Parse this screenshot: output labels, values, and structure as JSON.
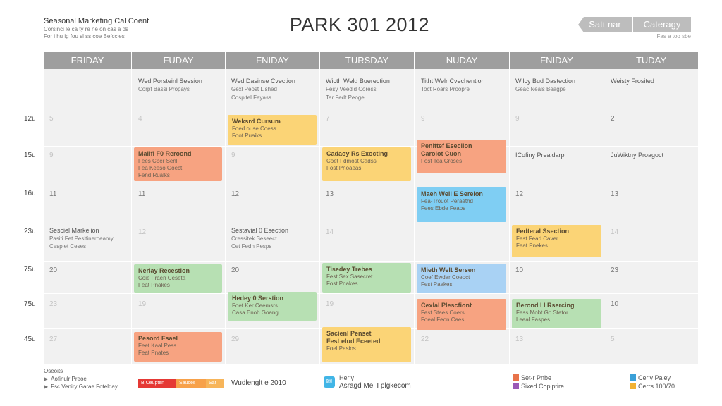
{
  "header": {
    "brand_title": "Seasonal Marketing Cal Coent",
    "brand_sub1": "Corsinci le ca ty re ne on cas a ds",
    "brand_sub2": "For i hu ig fou sl ss coe Befccles",
    "title": "PARK 301 2012",
    "btn_1": "Satt nar",
    "btn_2": "Cateragy",
    "sub_right": "Fas a too sbe"
  },
  "days": [
    "FRIDAY",
    "FUDAY",
    "FNIDAY",
    "TURSDAY",
    "NUDAY",
    "FNIDAY",
    "TUDAY"
  ],
  "subheads": [
    {
      "l1": "",
      "l2": ""
    },
    {
      "l1": "Wed Porsteinl Seesion",
      "l2": "Corpt Bassi Propays"
    },
    {
      "l1": "Wed Dasinse Cvection",
      "l2": "Gexl Peost Lished"
    },
    {
      "l1": "Wicth Weld Buerection",
      "l2": "Fesy Veedid Coress"
    },
    {
      "l1": "Titht Welr Cvechention",
      "l2": "Toct Roars Proopre"
    },
    {
      "l1": "Wilcy Bud Dastection",
      "l2": "Geac Neals Beagpe"
    },
    {
      "l1": "Weisty Frosited",
      "l2": ""
    }
  ],
  "subheads_l3": [
    "",
    "",
    "Cospitel Feyass",
    "Tar Fedt Peoge",
    "",
    "",
    ""
  ],
  "times": [
    "12u",
    "15u",
    "16u",
    "23u",
    "75u",
    "75u",
    "45u"
  ],
  "day_numbers": {
    "r1": [
      "5",
      "4",
      "",
      "7",
      "9",
      "9",
      "2"
    ],
    "r2": [
      "9",
      "",
      "9",
      "",
      "",
      "",
      ""
    ],
    "r3": [
      "11",
      "11",
      "12",
      "13",
      "",
      "12",
      "13"
    ],
    "r4": [
      "",
      "12",
      "",
      "14",
      "",
      "",
      "14"
    ],
    "r5": [
      "20",
      "",
      "20",
      "",
      "",
      "10",
      "23"
    ],
    "r6": [
      "23",
      "19",
      "",
      "19",
      "",
      "",
      "10"
    ],
    "r7": [
      "27",
      "",
      "29",
      "",
      "22",
      "13",
      "5"
    ]
  },
  "cell_texts": {
    "mon_r4": {
      "l1": "Sesciel Markelion",
      "l2": "Pasiti Fet Pesltineroeamy",
      "l3": "Cespiet Ceses"
    },
    "wed_r4": {
      "l1": "Sestavial 0 Esection",
      "l2": "Cressitek Seseect",
      "l3": "Cet Fedn Pesps"
    },
    "sat_r2": {
      "l1": "ICofiny Prealdarp"
    },
    "sun_r2": {
      "l1": "JuWiktny Proagoct"
    }
  },
  "events": [
    {
      "title": "Weksrd Cursum",
      "d1": "Foed ouse Coess",
      "d2": "Foot Puaiks"
    },
    {
      "title": "Malifl F0 Reroond",
      "d1": "Fees Cber Senl",
      "d2": "Fea Keeso Goect"
    },
    {
      "title": "Fend Rualks",
      "d1": "",
      "d2": ""
    },
    {
      "title": "Cadaoy Rs Exocting",
      "d1": "Coet Fdmost Cadss",
      "d2": "Fost Pnoaeas"
    },
    {
      "title": "Penittef Eseciion",
      "d1": "Caroiot Cuon",
      "d2": "Fost Tea Croses"
    },
    {
      "title": "Maeh Weil E Sereion",
      "d1": "Fea-Trouot Peraethd",
      "d2": "Fees Ebde Feaos"
    },
    {
      "title": "Fedteral Ssection",
      "d1": "Fest Fead Caver",
      "d2": "Feat Pnekes"
    },
    {
      "title": "Nerlay Recestion",
      "d1": "Coie Fraen Ceseta",
      "d2": "Feat Pnakes"
    },
    {
      "title": "Tisedey Trebes",
      "d1": "Fest Sex Sasecret",
      "d2": "Fost Pnakes"
    },
    {
      "title": "Mieth Welt Sersen",
      "d1": "Coef Ewdar Coeoct",
      "d2": "Fest Paakes"
    },
    {
      "title": "Hedey 0 Serstion",
      "d1": "Foet Ker Ceemsrs",
      "d2": "Casa Enoh Goang"
    },
    {
      "title": "Cexlal Plescfiont",
      "d1": "Fest Staes Coers",
      "d2": "Foeal Feon Caes"
    },
    {
      "title": "Berond I I Rsercing",
      "d1": "Fess Mobt Go Stetor",
      "d2": "Leeal Faspes"
    },
    {
      "title": "Pesord Fsael",
      "d1": "Feet Kaal Pess",
      "d2": "Feat Pnates"
    },
    {
      "title": "Sacienl Penset",
      "d1": "Fest elud Eceeted",
      "d2": "Foel Pasios"
    }
  ],
  "footer": {
    "legend_title": "Oseoits",
    "legend_1": "Aofinulr Preoe",
    "legend_2": "Fsc Veniry Garae Fotelday",
    "bar_1": "B Ceupten",
    "bar_2": "Sauces",
    "bar_3": "Sar",
    "copyright": "Wudlenglt e 2010",
    "app_title": "Heriy",
    "app_sub": "Asragd Mel I plgkecom",
    "r1_l1": "Set-r Pnbe",
    "r1_l2": "Sixed Copiptire",
    "r2_l1": "Cerly Paiey",
    "r2_l2": "Cerrs 100/70"
  },
  "colors": {
    "header_gray": "#9e9e9e",
    "orange": "#f7a381",
    "yellow": "#fbd476",
    "green": "#b7e0b3",
    "blue": "#7fcef3",
    "light_blue": "#a9d2f4"
  }
}
